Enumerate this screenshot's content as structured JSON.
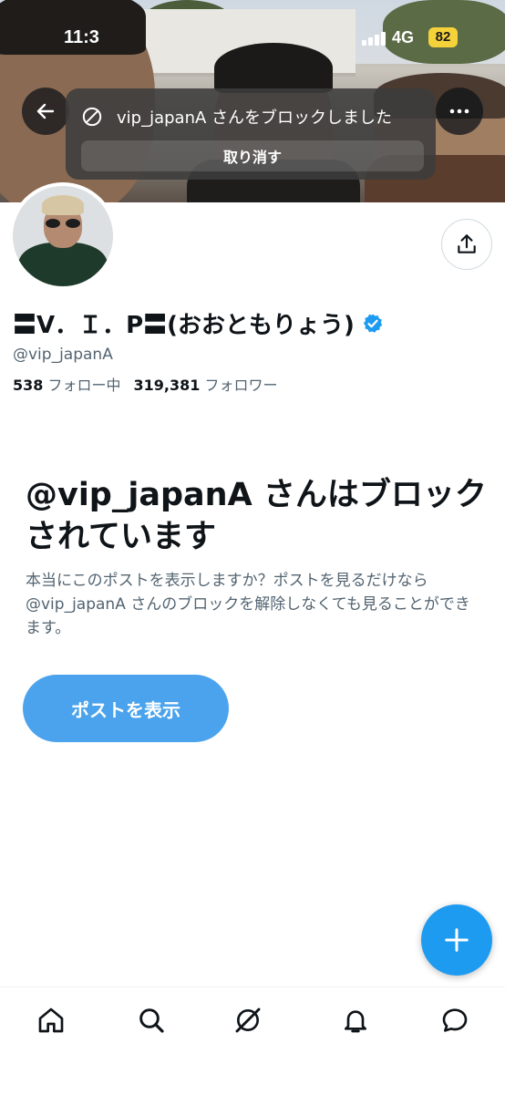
{
  "status_bar": {
    "time": "11:3",
    "network": "4G",
    "battery": "82"
  },
  "toast": {
    "message": "vip_japanA さんをブロックしました",
    "undo_label": "取り消す"
  },
  "profile": {
    "display_name": "〓V．Ｉ．P〓(おおともりょう)",
    "handle": "@vip_japanA",
    "following_count": "538",
    "following_label": "フォロー中",
    "followers_count": "319,381",
    "followers_label": "フォロワー"
  },
  "blocked": {
    "title": "@vip_japanA さんはブロックされています",
    "description": "本当にこのポストを表示しますか？ポストを見るだけなら @vip_japanA さんのブロックを解除しなくても見ることができます。",
    "show_posts_label": "ポストを表示"
  },
  "fab": {
    "label": "+"
  },
  "bottom_nav": {
    "items": [
      "home-icon",
      "search-icon",
      "grok-icon",
      "notifications-icon",
      "messages-icon"
    ]
  },
  "colors": {
    "accent": "#1d9bf0",
    "button": "#4aa3ec",
    "secondary_text": "#536471",
    "battery": "#f5d23a"
  }
}
